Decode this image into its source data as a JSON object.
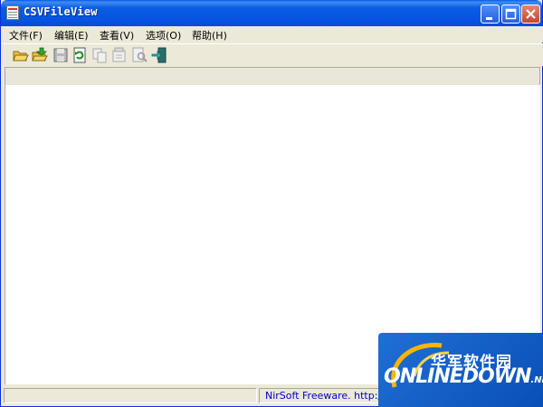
{
  "window": {
    "title": "CSVFileView",
    "buttons": {
      "minimize": "minimize",
      "maximize": "maximize",
      "close": "close"
    }
  },
  "menubar": {
    "items": [
      {
        "label": "文件(F)"
      },
      {
        "label": "编辑(E)"
      },
      {
        "label": "查看(V)"
      },
      {
        "label": "选项(O)"
      },
      {
        "label": "帮助(H)"
      }
    ]
  },
  "toolbar": {
    "icons": [
      "open-folder-icon",
      "open-file-icon",
      "save-icon",
      "refresh-icon",
      "copy-icon",
      "properties-icon",
      "find-icon",
      "exit-icon"
    ]
  },
  "statusbar": {
    "left_text": "",
    "credit_text": "NirSoft Freeware.  http://w"
  },
  "watermark": {
    "cn_text": "华军软件园",
    "en_text": "ONLINEDOWN",
    "net_text": ".NET"
  },
  "colors": {
    "title_bar": "#0554e2",
    "close_button": "#c9442a",
    "status_link": "#0000cc",
    "watermark_bg": "#1f6fd6"
  }
}
